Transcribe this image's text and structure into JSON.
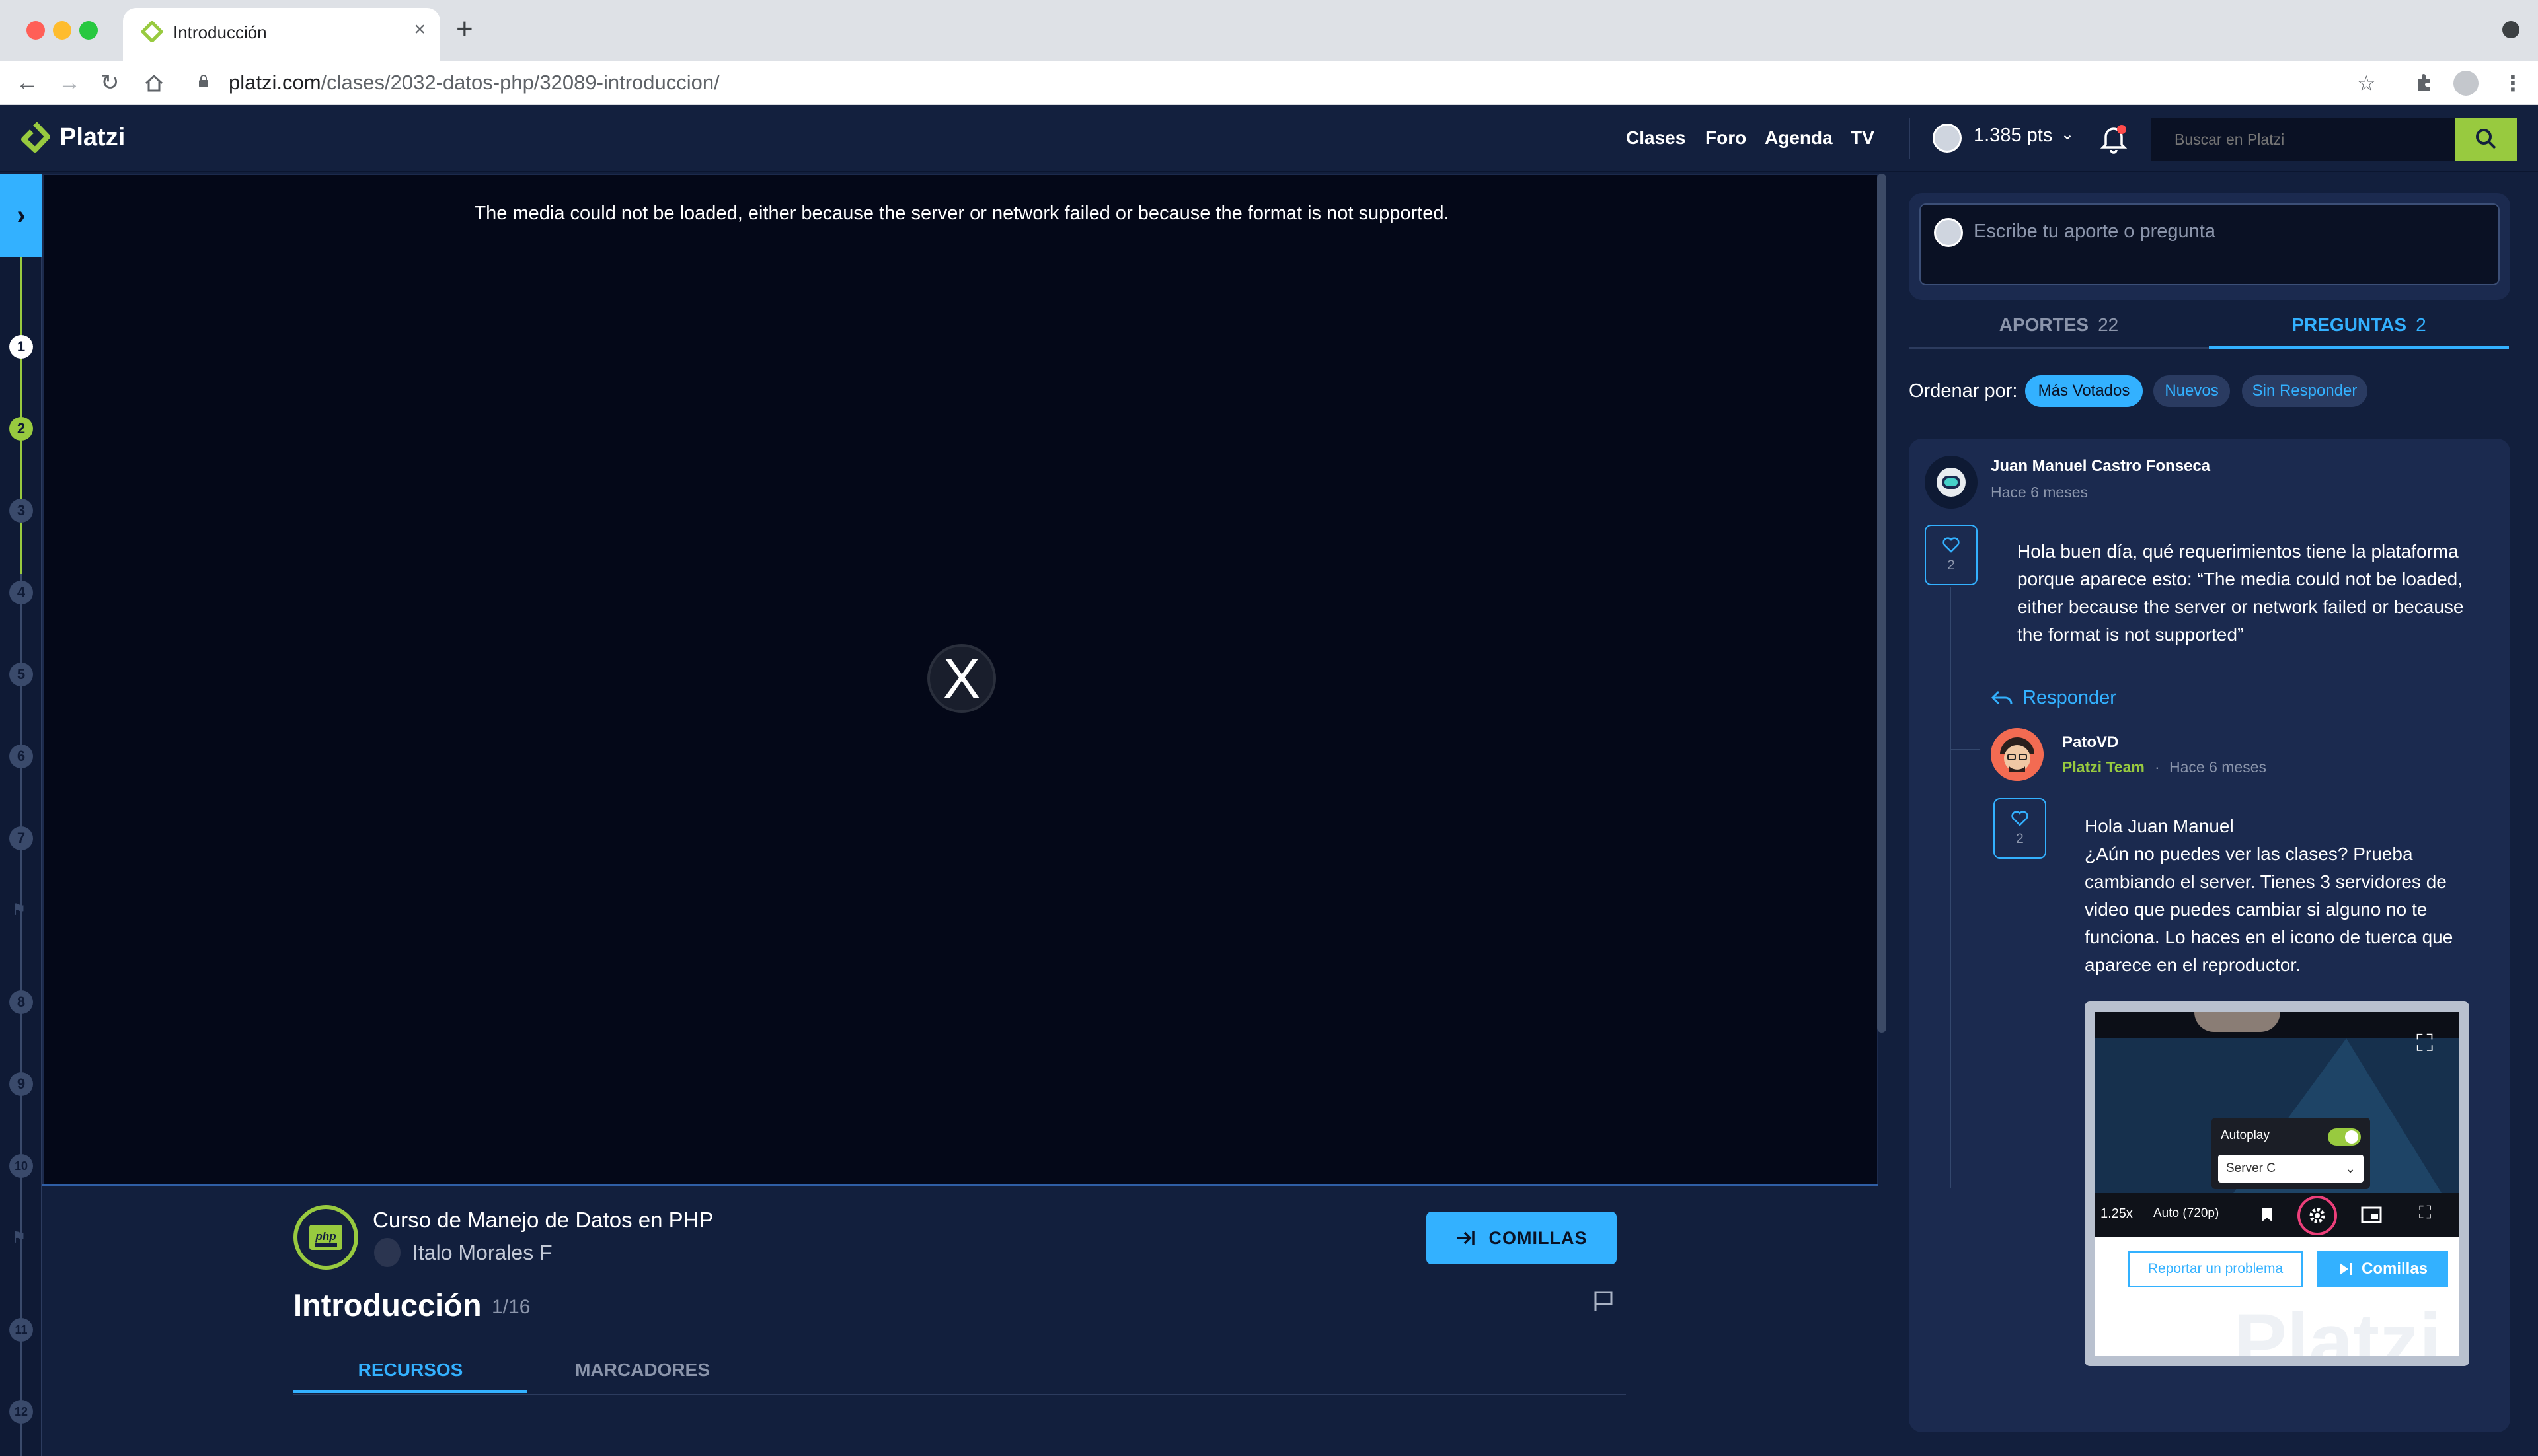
{
  "browser": {
    "tab_title": "Introducción",
    "tab_close": "×",
    "new_tab": "+",
    "url_host": "platzi.com",
    "url_path": "/clases/2032-datos-php/32089-introduccion/"
  },
  "header": {
    "logo_text": "Platzi",
    "nav": [
      "Clases",
      "Foro",
      "Agenda",
      "TV"
    ],
    "points": "1.385 pts",
    "search_placeholder": "Buscar en Platzi",
    "colors": {
      "background": "#13203e",
      "accent_green": "#98ca3f",
      "accent_blue": "#33b1ff"
    }
  },
  "rail": {
    "items": [
      "1",
      "2",
      "3",
      "4",
      "5",
      "6",
      "7",
      "8",
      "9",
      "10",
      "11",
      "12"
    ]
  },
  "video": {
    "error_message": "The media could not be loaded, either because the server or network failed or because the format is not supported.",
    "error_glyph": "X"
  },
  "course": {
    "name": "Curso de Manejo de Datos en PHP",
    "teacher": "Italo Morales F",
    "comillas_label": "COMILLAS",
    "class_title": "Introducción",
    "class_count": "1/16",
    "tabs": [
      "RECURSOS",
      "MARCADORES"
    ]
  },
  "comments": {
    "ask_placeholder": "Escribe tu aporte o pregunta",
    "tabs": [
      {
        "label": "APORTES",
        "count": "22"
      },
      {
        "label": "PREGUNTAS",
        "count": "2"
      }
    ],
    "order_label": "Ordenar por:",
    "order_options": [
      "Más Votados",
      "Nuevos",
      "Sin Responder"
    ],
    "question": {
      "author": "Juan Manuel Castro Fonseca",
      "time": "Hace 6 meses",
      "likes": "2",
      "text": "Hola buen día, qué requerimientos tiene la plataforma porque aparece esto: “The media could not be loaded, either because the server or network failed or because the format is not supported”",
      "reply_label": "Responder"
    },
    "answer": {
      "author": "PatoVD",
      "badge": "Platzi Team",
      "separator": "·",
      "time": "Hace 6 meses",
      "likes": "2",
      "greeting": "Hola Juan Manuel",
      "text": "¿Aún no puedes ver las clases? Prueba cambiando el server. Tienes 3 servidores de video que puedes cambiar si alguno no te funciona. Lo haces en el icono de tuerca que aparece en el reproductor."
    },
    "screenshot": {
      "autoplay_label": "Autoplay",
      "server_option": "Server C",
      "speed": "1.25x",
      "quality": "Auto (720p)",
      "report_label": "Reportar un problema",
      "comillas_label": "Comillas",
      "watermark": "Platzi"
    }
  }
}
